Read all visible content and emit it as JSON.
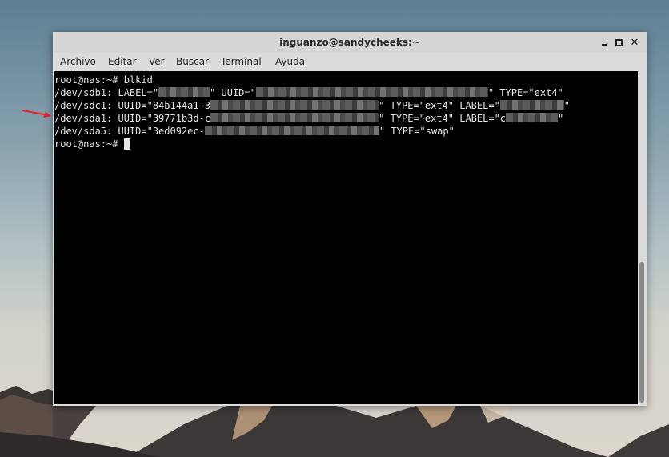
{
  "window": {
    "title": "inguanzo@sandycheeks:~"
  },
  "menubar": {
    "items": [
      "Archivo",
      "Editar",
      "Ver",
      "Buscar",
      "Terminal",
      "Ayuda"
    ]
  },
  "terminal": {
    "prompt": "root@nas:~# ",
    "command": "blkid",
    "lines": [
      {
        "a": "/dev/sdb1: LABEL=\"",
        "b": "\" UUID=\"",
        "c": "\" TYPE=\"ext4\""
      },
      {
        "a": "/dev/sdc1: UUID=\"84b144a1-3",
        "b": "\" TYPE=\"ext4\" LABEL=\"",
        "c": "\""
      },
      {
        "a": "/dev/sda1: UUID=\"39771b3d-c",
        "b": "\" TYPE=\"ext4\" LABEL=\"c",
        "c": "\""
      },
      {
        "a": "/dev/sda5: UUID=\"3ed092ec-",
        "b": "\" TYPE=\"swap\""
      }
    ]
  },
  "icons": {
    "minimize": "minimize-icon",
    "maximize": "maximize-icon",
    "close": "close-icon",
    "annotation": "red-arrow-icon"
  },
  "colors": {
    "terminal_bg": "#000000",
    "terminal_fg": "#e5e5e5",
    "arrow": "#e8202a"
  }
}
